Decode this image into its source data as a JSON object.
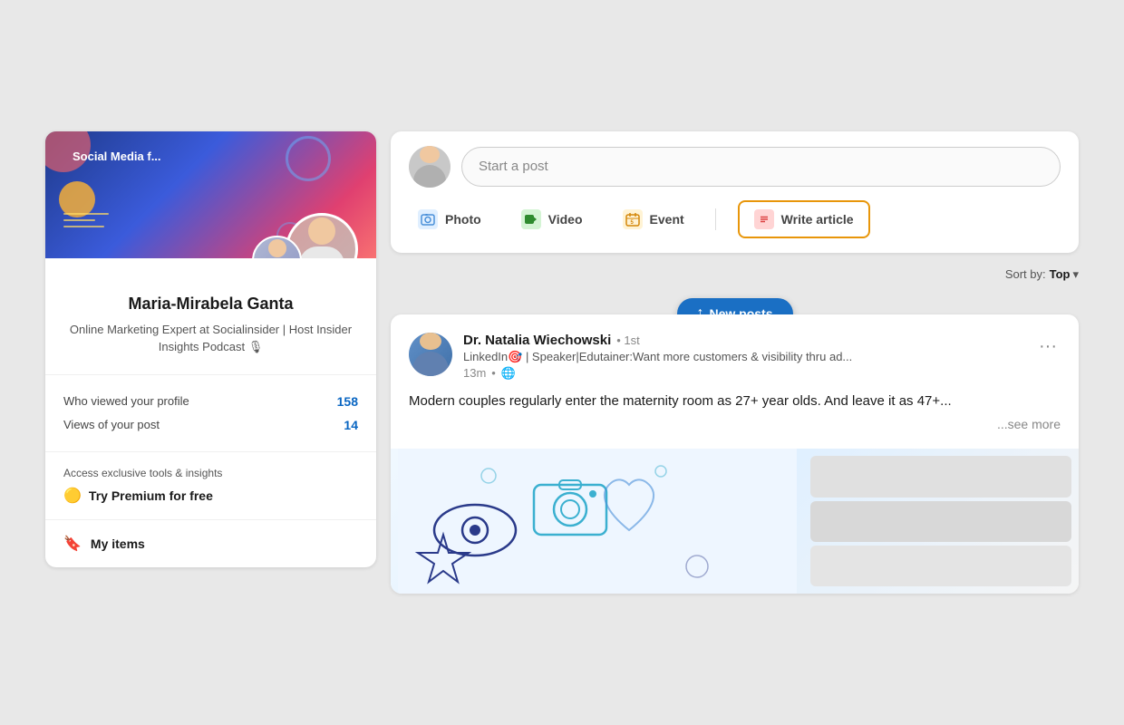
{
  "page": {
    "background": "#e8e8e8"
  },
  "left_panel": {
    "banner": {
      "text": "Social Media f..."
    },
    "profile": {
      "name": "Maria-Mirabela Ganta",
      "bio": "Online Marketing Expert at Socialinsider | Host Insider Insights Podcast 🎙"
    },
    "stats": {
      "who_viewed_label": "Who viewed your profile",
      "who_viewed_value": "158",
      "views_post_label": "Views of your post",
      "views_post_value": "14"
    },
    "premium": {
      "teaser": "Access exclusive tools & insights",
      "cta": "Try Premium for free",
      "icon": "🟡"
    },
    "my_items": {
      "label": "My items",
      "icon": "🔖"
    }
  },
  "right_panel": {
    "composer": {
      "placeholder": "Start a post",
      "actions": {
        "photo": "Photo",
        "video": "Video",
        "event": "Event",
        "write_article": "Write article"
      }
    },
    "sort": {
      "label": "Sort by:",
      "value": "Top",
      "chevron": "▾"
    },
    "new_posts_pill": {
      "arrow": "↑",
      "label": "New posts"
    },
    "post": {
      "author": {
        "name": "Dr. Natalia Wiechowski",
        "degree": "• 1st",
        "bio": "LinkedIn🎯 | Speaker|Edutainer:Want more customers & visibility thru ad...",
        "time": "13m",
        "globe": "🌐"
      },
      "content": "Modern couples regularly enter the maternity room as 27+ year olds. And leave it as 47+...",
      "see_more": "...see more"
    }
  }
}
